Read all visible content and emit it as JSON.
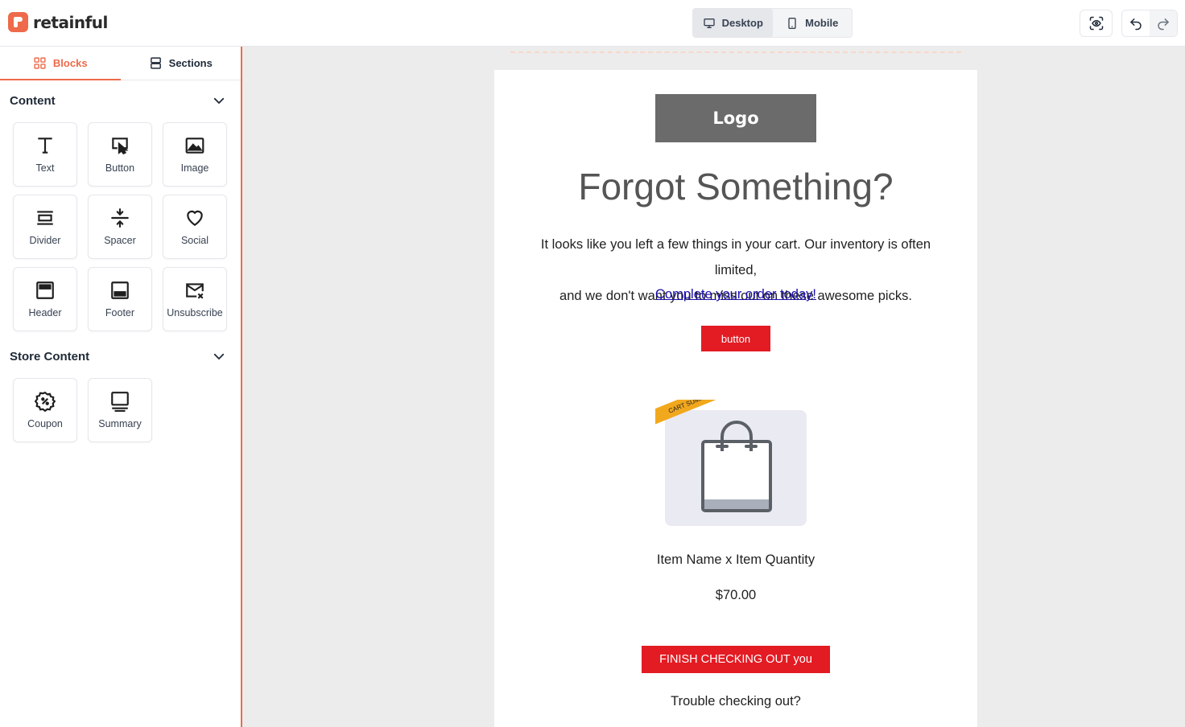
{
  "app": {
    "brand": "retainful",
    "accent": "#ee6a4a"
  },
  "device_toggle": {
    "desktop": "Desktop",
    "mobile": "Mobile",
    "selected": "Desktop"
  },
  "toolbar": {
    "preview_icon": "eye-scan-icon",
    "undo_icon": "undo-icon",
    "redo_icon": "redo-icon"
  },
  "sidebar": {
    "tabs": [
      {
        "label": "Blocks",
        "icon": "grid-icon",
        "active": true
      },
      {
        "label": "Sections",
        "icon": "sections-icon",
        "active": false
      }
    ],
    "content_group": {
      "title": "Content",
      "blocks": [
        {
          "label": "Text",
          "icon": "text-icon"
        },
        {
          "label": "Button",
          "icon": "button-icon"
        },
        {
          "label": "Image",
          "icon": "image-icon"
        },
        {
          "label": "Divider",
          "icon": "divider-icon"
        },
        {
          "label": "Spacer",
          "icon": "spacer-icon"
        },
        {
          "label": "Social",
          "icon": "heart-icon"
        },
        {
          "label": "Header",
          "icon": "header-icon"
        },
        {
          "label": "Footer",
          "icon": "footer-icon"
        },
        {
          "label": "Unsubscribe",
          "icon": "mail-x-icon"
        }
      ]
    },
    "store_group": {
      "title": "Store Content",
      "blocks": [
        {
          "label": "Coupon",
          "icon": "coupon-icon"
        },
        {
          "label": "Summary",
          "icon": "summary-icon"
        }
      ]
    }
  },
  "email": {
    "logo": "Logo",
    "headline": "Forgot Something?",
    "body_line1": "It looks like you left a few things in your cart. Our inventory is often limited,",
    "body_line2": "and we don't want you to miss out on these awesome picks.",
    "link": "Complete your order today!",
    "button": "button",
    "ribbon": "CART SUMMARY EXAMPLE",
    "product_icon": "shopping-bag-icon",
    "item": "Item Name x Item Quantity",
    "price": "$70.00",
    "checkout_button": "FINISH CHECKING OUT you",
    "trouble": "Trouble checking out?",
    "button_color": "#e31b23",
    "ribbon_color": "#f2a81d"
  }
}
